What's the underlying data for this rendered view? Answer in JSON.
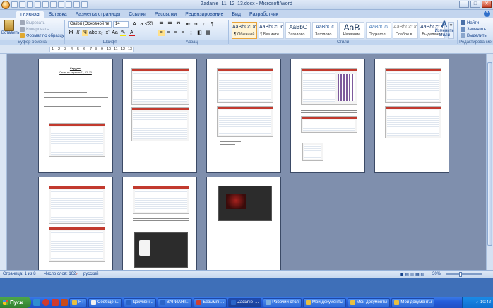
{
  "window": {
    "title": "Zadanie_11_12_13.docx - Microsoft Word",
    "controls": [
      "–",
      "□",
      "✕"
    ]
  },
  "ribbon_tabs": [
    "Главная",
    "Вставка",
    "Разметка страницы",
    "Ссылки",
    "Рассылки",
    "Рецензирование",
    "Вид",
    "Разработчик"
  ],
  "active_tab": "Главная",
  "clipboard": {
    "paste": "Вставить",
    "cut": "Вырезать",
    "copy": "Копировать",
    "format_painter": "Формат по образцу",
    "label": "Буфер обмена"
  },
  "font": {
    "name": "Calibri (Основной те",
    "size": "14",
    "label": "Шрифт"
  },
  "paragraph": {
    "label": "Абзац"
  },
  "styles": {
    "label": "Стили",
    "items": [
      {
        "sample": "AaBbCcDc",
        "name": "¶ Обычный",
        "active": true
      },
      {
        "sample": "AaBbCcDc",
        "name": "¶ Без инте...",
        "active": false
      },
      {
        "sample": "AaBbC",
        "name": "Заголово...",
        "active": false
      },
      {
        "sample": "AaBbCc",
        "name": "Заголово...",
        "active": false
      },
      {
        "sample": "AaB",
        "name": "Название",
        "active": false
      },
      {
        "sample": "AaBbCcI",
        "name": "Подзагол...",
        "active": false
      },
      {
        "sample": "AaBbCcDc",
        "name": "Слабое в...",
        "active": false
      },
      {
        "sample": "AaBbCcDc",
        "name": "Выделение",
        "active": false
      }
    ],
    "change_styles": "Изменить стили"
  },
  "editing": {
    "label": "Редактирование",
    "find": "Найти",
    "replace": "Заменить",
    "select": "Выделить"
  },
  "ruler_numbers": [
    "1",
    "2",
    "3",
    "4",
    "5",
    "6",
    "7",
    "8",
    "9",
    "10",
    "11",
    "12",
    "13"
  ],
  "page1": {
    "title": "Студент",
    "line2": "Отчет по заданию 11, 12, 13"
  },
  "status": {
    "page": "Страница: 1 из 8",
    "words": "Число слов: 162",
    "language": "русский",
    "zoom": "30%"
  },
  "taskbar": {
    "start": "Пуск",
    "tasks": [
      {
        "label": "НТ",
        "color": "#e8c040"
      },
      {
        "label": "Сообщен...",
        "color": "#f0f0f0"
      },
      {
        "label": "Докумен...",
        "color": "#2a64c8"
      },
      {
        "label": "ВАРИАНТ...",
        "color": "#2a64c8"
      },
      {
        "label": "Безымян...",
        "color": "#d04030"
      },
      {
        "label": "Zadanie_...",
        "color": "#2a64c8",
        "active": true
      },
      {
        "label": "Рабочий стол",
        "color": "#7fb0e0"
      },
      {
        "label": "Мои документы",
        "color": "#e8c040"
      },
      {
        "label": "Мои документы",
        "color": "#e8c040"
      },
      {
        "label": "Мои документы",
        "color": "#e8c040"
      }
    ],
    "clock": "10:42"
  }
}
